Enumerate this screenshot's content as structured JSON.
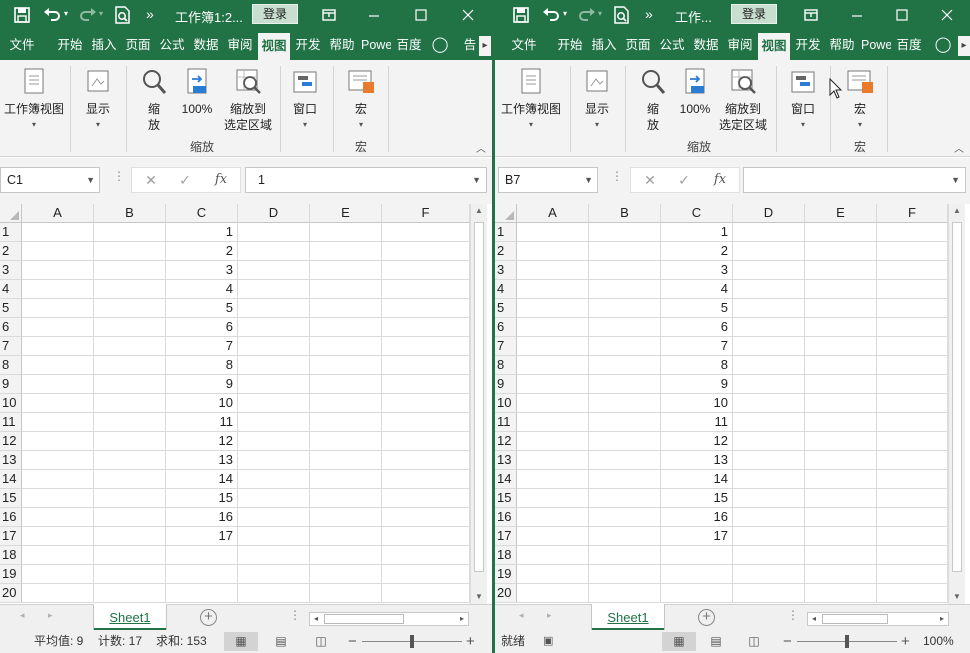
{
  "windows": [
    {
      "id": "left",
      "title": "工作簿1:2...",
      "login": "登录",
      "more": "»",
      "tabs": [
        "文件",
        "开始",
        "插入",
        "页面",
        "公式",
        "数据",
        "审阅",
        "视图",
        "开发",
        "帮助",
        "Powe",
        "百度",
        "告"
      ],
      "active_tab": "视图",
      "ribbon": {
        "workbook_view": "工作簿视图",
        "show": "显示",
        "zoom": "缩放",
        "zoom_line1": "缩",
        "zoom_line2": "放",
        "zoom100": "100%",
        "zoom_sel_line1": "缩放到",
        "zoom_sel_line2": "选定区域",
        "zoom_group": "缩放",
        "window": "窗口",
        "macro": "宏",
        "macro_group": "宏"
      },
      "name_box": "C1",
      "formula_value": "1",
      "columns": [
        "A",
        "B",
        "C",
        "D",
        "E",
        "F"
      ],
      "row_numbers": [
        "1",
        "2",
        "3",
        "4",
        "5",
        "6",
        "7",
        "8",
        "9",
        "10",
        "11",
        "12",
        "13",
        "14",
        "15",
        "16",
        "17",
        "18",
        "19",
        "20"
      ],
      "col_c_values": [
        "1",
        "2",
        "3",
        "4",
        "5",
        "6",
        "7",
        "8",
        "9",
        "10",
        "11",
        "12",
        "13",
        "14",
        "15",
        "16",
        "17"
      ],
      "sheet_tab": "Sheet1",
      "status": {
        "average": "平均值: 9",
        "count": "计数: 17",
        "sum": "求和: 153"
      }
    },
    {
      "id": "right",
      "title": "工作...",
      "login": "登录",
      "more": "»",
      "tabs": [
        "文件",
        "开始",
        "插入",
        "页面",
        "公式",
        "数据",
        "审阅",
        "视图",
        "开发",
        "帮助",
        "Powe",
        "百度"
      ],
      "active_tab": "视图",
      "ribbon": {
        "workbook_view": "工作簿视图",
        "show": "显示",
        "zoom": "缩放",
        "zoom_line1": "缩",
        "zoom_line2": "放",
        "zoom100": "100%",
        "zoom_sel_line1": "缩放到",
        "zoom_sel_line2": "选定区域",
        "zoom_group": "缩放",
        "window": "窗口",
        "macro": "宏",
        "macro_group": "宏"
      },
      "name_box": "B7",
      "formula_value": "",
      "columns": [
        "A",
        "B",
        "C",
        "D",
        "E",
        "F"
      ],
      "row_numbers": [
        "1",
        "2",
        "3",
        "4",
        "5",
        "6",
        "7",
        "8",
        "9",
        "10",
        "11",
        "12",
        "13",
        "14",
        "15",
        "16",
        "17",
        "18",
        "19",
        "20"
      ],
      "col_c_values": [
        "1",
        "2",
        "3",
        "4",
        "5",
        "6",
        "7",
        "8",
        "9",
        "10",
        "11",
        "12",
        "13",
        "14",
        "15",
        "16",
        "17"
      ],
      "sheet_tab": "Sheet1",
      "status": {
        "ready": "就绪",
        "zoom_level": "100%"
      }
    }
  ],
  "colors": {
    "excel_green": "#217346",
    "ribbon_bg": "#f3f3f3",
    "grid_line": "#dadada"
  }
}
